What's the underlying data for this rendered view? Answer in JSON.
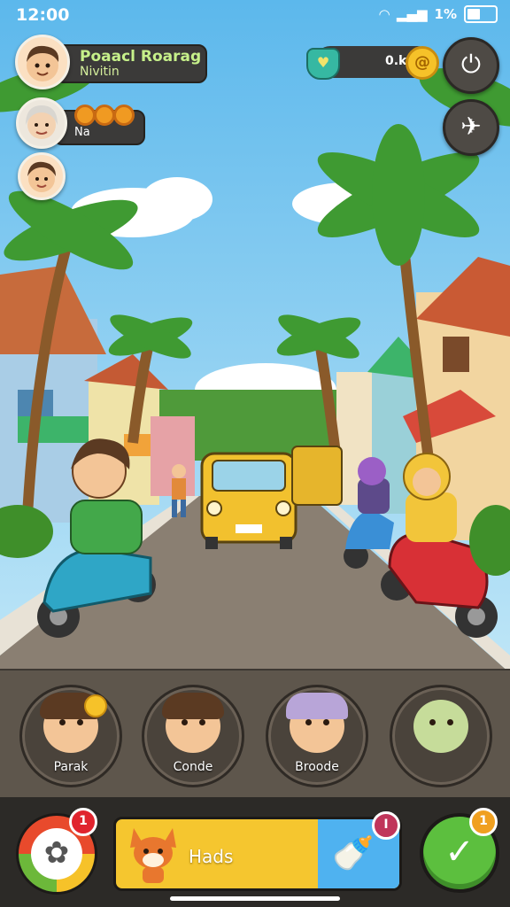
{
  "status_bar": {
    "time": "12:00",
    "battery_text": "1%"
  },
  "hud": {
    "player1": {
      "name": "Poaacl Roarag",
      "subtitle": "Nivitin"
    },
    "player2": {
      "label": "Na"
    },
    "coins": {
      "value": "0.k",
      "coin_symbol": "@"
    },
    "power_icon": "power-icon",
    "bird_icon": "bird-icon"
  },
  "characters": [
    {
      "name": "Parak",
      "hair": "#5b3a22"
    },
    {
      "name": "Conde",
      "hair": "#5b3a22"
    },
    {
      "name": "Broode",
      "hair": "#b8a5d8"
    },
    {
      "name": "",
      "hair": "#b9d48a"
    }
  ],
  "bottom_bar": {
    "left_badge": "1",
    "middle_label": "Hads",
    "middle_badge": "I",
    "right_badge": "1"
  },
  "colors": {
    "sky": "#87cdf0",
    "road": "#8a7f72",
    "accent_green": "#5cbf3e",
    "accent_yellow": "#f5c62f"
  }
}
